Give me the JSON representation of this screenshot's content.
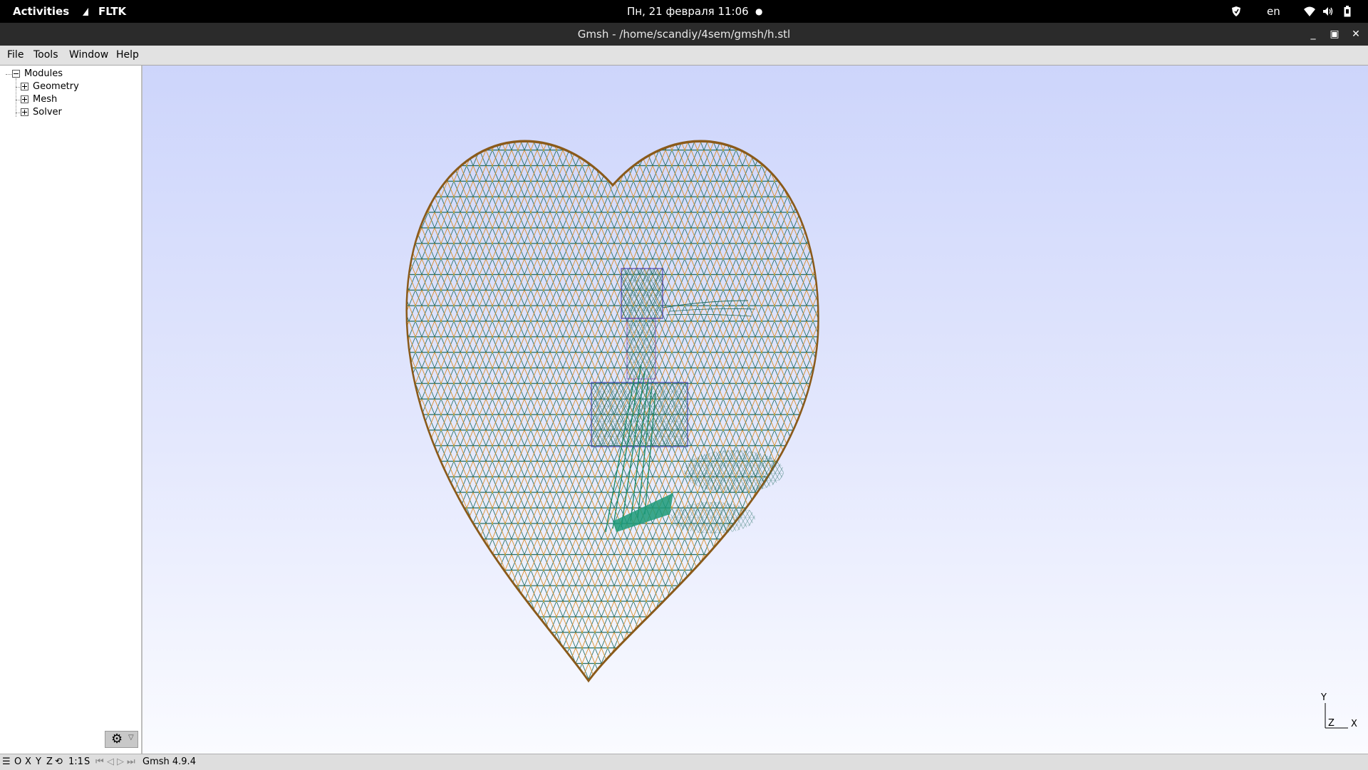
{
  "topbar": {
    "activities": "Activities",
    "app_name": "FLTK",
    "clock": "Пн, 21 февраля  11:06",
    "indicator": "●",
    "language": "en",
    "icons": [
      "shield-icon",
      "wifi-icon",
      "volume-icon",
      "battery-icon"
    ]
  },
  "window": {
    "title": "Gmsh - /home/scandiy/4sem/gmsh/h.stl",
    "minimize": "_",
    "maximize": "▣",
    "close": "✕"
  },
  "menubar": {
    "file": "File",
    "tools": "Tools",
    "window": "Window",
    "help": "Help"
  },
  "tree": {
    "root": "Modules",
    "items": [
      "Geometry",
      "Mesh",
      "Solver"
    ]
  },
  "viewport": {
    "mesh_description": "heart-shaped STL surface mesh wireframe",
    "axes": {
      "y": "Y",
      "z": "Z",
      "x": "X"
    }
  },
  "statusbar": {
    "menu_icon": "☰",
    "o": "O",
    "x": "X",
    "y": "Y",
    "z": "Z",
    "rotate_icon": "⟲",
    "scale": "1:1",
    "s": "S",
    "version": "Gmsh 4.9.4"
  },
  "colors": {
    "mesh_edge_dark": "#1f6b5f",
    "mesh_edge_orange": "#d98a1f",
    "mesh_edge_yellow": "#e6c63a",
    "background_top": "#cdd5fb",
    "background_bottom": "#fafbff"
  }
}
